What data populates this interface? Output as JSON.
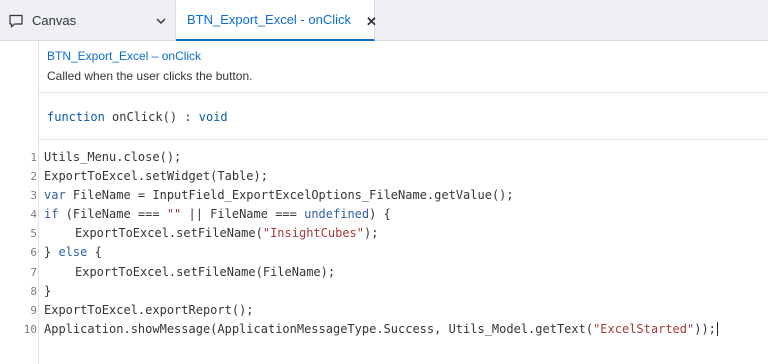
{
  "tabs": {
    "canvas": {
      "label": "Canvas",
      "icon": "comment-icon",
      "menu_icon": "chevron-down-icon"
    },
    "active": {
      "label": "BTN_Export_Excel - onClick",
      "close_icon": "close-icon"
    }
  },
  "header": {
    "title": "BTN_Export_Excel – onClick",
    "description": "Called when the user clicks the button."
  },
  "signature": {
    "keyword": "function",
    "name": "onClick() :",
    "return_type": "void"
  },
  "code": {
    "lines": [
      {
        "n": "1",
        "tokens": [
          {
            "t": "Utils_Menu.close();"
          }
        ]
      },
      {
        "n": "2",
        "tokens": [
          {
            "t": "ExportToExcel.setWidget(Table);"
          }
        ]
      },
      {
        "n": "3",
        "tokens": [
          {
            "t": "var",
            "k": "kw"
          },
          {
            "t": " FileName = InputField_ExportExcelOptions_FileName.getValue();"
          }
        ]
      },
      {
        "n": "4",
        "tokens": [
          {
            "t": "if",
            "k": "kw"
          },
          {
            "t": " (FileName === "
          },
          {
            "t": "\"\"",
            "k": "str"
          },
          {
            "t": " || FileName === "
          },
          {
            "t": "undefined",
            "k": "kw"
          },
          {
            "t": ") {"
          }
        ]
      },
      {
        "n": "5",
        "indent": true,
        "tokens": [
          {
            "t": "ExportToExcel.setFileName("
          },
          {
            "t": "\"InsightCubes\"",
            "k": "str"
          },
          {
            "t": ");"
          }
        ]
      },
      {
        "n": "6",
        "tokens": [
          {
            "t": "} "
          },
          {
            "t": "else",
            "k": "kw"
          },
          {
            "t": " {"
          }
        ]
      },
      {
        "n": "7",
        "indent": true,
        "tokens": [
          {
            "t": "ExportToExcel.setFileName(FileName);"
          }
        ]
      },
      {
        "n": "8",
        "tokens": [
          {
            "t": "}"
          }
        ]
      },
      {
        "n": "9",
        "tokens": [
          {
            "t": "ExportToExcel.exportReport();"
          }
        ]
      },
      {
        "n": "10",
        "cursor": true,
        "tokens": [
          {
            "t": "Application.showMessage(ApplicationMessageType.Success, Utils_Model.getText("
          },
          {
            "t": "\"ExcelStarted\"",
            "k": "str"
          },
          {
            "t": "));"
          }
        ]
      }
    ]
  },
  "colors": {
    "accent": "#0a6ed1",
    "keyword": "#2e5ea8",
    "string": "#a43a3a"
  }
}
